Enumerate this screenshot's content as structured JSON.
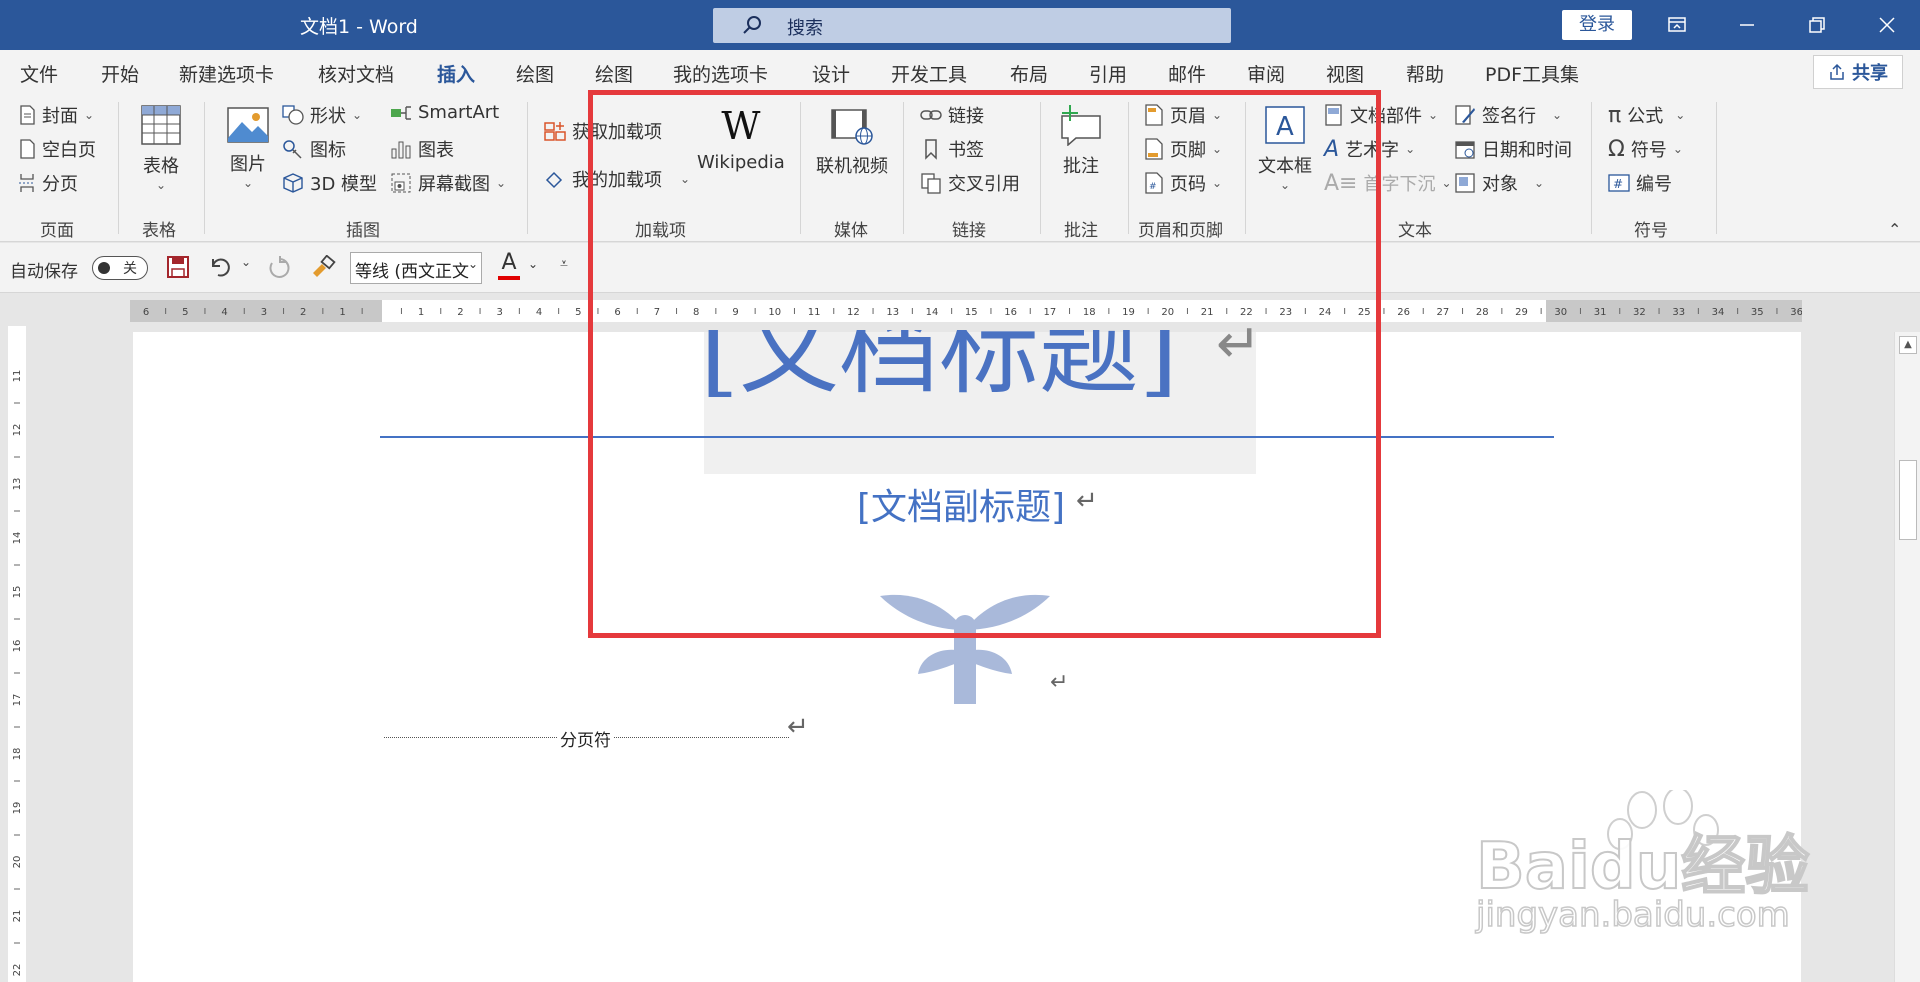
{
  "titlebar": {
    "doc_title": "文档1  -  Word",
    "search_placeholder": "搜索",
    "login": "登录"
  },
  "tabs": [
    "文件",
    "开始",
    "新建选项卡",
    "核对文档",
    "插入",
    "绘图",
    "绘图",
    "我的选项卡",
    "设计",
    "开发工具",
    "布局",
    "引用",
    "邮件",
    "审阅",
    "视图",
    "帮助",
    "PDF工具集"
  ],
  "active_tab": "插入",
  "share": "共享",
  "ribbon": {
    "pages": {
      "cover": "封面",
      "blank": "空白页",
      "break": "分页",
      "group": "页面"
    },
    "tables": {
      "table": "表格",
      "group": "表格"
    },
    "illustrations": {
      "picture": "图片",
      "shapes": "形状",
      "icons": "图标",
      "model3d": "3D 模型",
      "smartart": "SmartArt",
      "chart": "图表",
      "screenshot": "屏幕截图",
      "group": "插图"
    },
    "addins": {
      "get": "获取加载项",
      "mine": "我的加载项",
      "wiki": "Wikipedia",
      "group": "加载项"
    },
    "media": {
      "video": "联机视频",
      "group": "媒体"
    },
    "links": {
      "link": "链接",
      "bookmark": "书签",
      "xref": "交叉引用",
      "group": "链接"
    },
    "comments": {
      "comment": "批注",
      "group": "批注"
    },
    "headerfooter": {
      "header": "页眉",
      "footer": "页脚",
      "pagenum": "页码",
      "group": "页眉和页脚"
    },
    "text": {
      "textbox": "文本框",
      "parts": "文档部件",
      "wordart": "艺术字",
      "dropcap": "首字下沉",
      "sigline": "签名行",
      "datetime": "日期和时间",
      "object": "对象",
      "group": "文本"
    },
    "symbols": {
      "equation": "公式",
      "symbol": "符号",
      "number": "编号",
      "group": "符号"
    }
  },
  "qat": {
    "autosave": "自动保存",
    "toggle": "关",
    "font": "等线 (西文正文"
  },
  "ruler_numbers": [
    "6",
    "5",
    "4",
    "3",
    "2",
    "1",
    "",
    "1",
    "2",
    "3",
    "4",
    "5",
    "6",
    "7",
    "8",
    "9",
    "10",
    "11",
    "12",
    "13",
    "14",
    "15",
    "16",
    "17",
    "18",
    "19",
    "20",
    "21",
    "22",
    "23",
    "24",
    "25",
    "26",
    "27",
    "28",
    "29",
    "30",
    "31",
    "32",
    "33",
    "34",
    "35",
    "36"
  ],
  "vruler_numbers": [
    "11",
    "12",
    "13",
    "14",
    "15",
    "16",
    "17",
    "18",
    "19",
    "20",
    "21",
    "22"
  ],
  "document": {
    "title": "[文档标题]",
    "subtitle": "[文档副标题]",
    "page_break": "分页符"
  },
  "watermark": {
    "logo": "Baidu经验",
    "url": "jingyan.baidu.com"
  },
  "colors": {
    "brand": "#2b579a",
    "highlight": "#e5393c",
    "doc_blue": "#4472c4"
  }
}
